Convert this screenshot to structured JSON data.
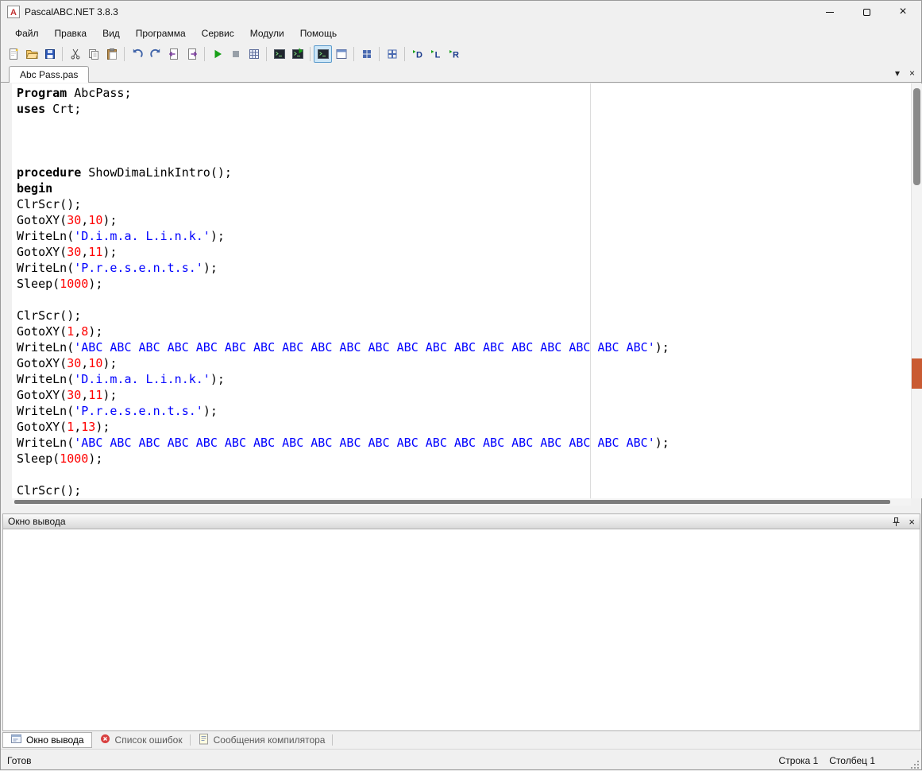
{
  "window": {
    "title": "PascalABC.NET 3.8.3"
  },
  "icons": {
    "window_close": "×",
    "tab_dropdown": "▾",
    "tab_close": "×",
    "output_close": "×"
  },
  "menu": {
    "items": [
      {
        "key": "file",
        "label": "Файл"
      },
      {
        "key": "edit",
        "label": "Правка"
      },
      {
        "key": "view",
        "label": "Вид"
      },
      {
        "key": "program",
        "label": "Программа"
      },
      {
        "key": "service",
        "label": "Сервис"
      },
      {
        "key": "modules",
        "label": "Модули"
      },
      {
        "key": "help",
        "label": "Помощь"
      }
    ]
  },
  "toolbar": {
    "groups": [
      [
        {
          "key": "new-file"
        },
        {
          "key": "open-file"
        },
        {
          "key": "save-file"
        }
      ],
      [
        {
          "key": "cut"
        },
        {
          "key": "copy"
        },
        {
          "key": "paste"
        }
      ],
      [
        {
          "key": "undo"
        },
        {
          "key": "redo"
        },
        {
          "key": "nav-back"
        },
        {
          "key": "nav-forward"
        }
      ],
      [
        {
          "key": "run"
        },
        {
          "key": "stop"
        },
        {
          "key": "expression-pad"
        }
      ],
      [
        {
          "key": "output-window"
        },
        {
          "key": "run-console"
        }
      ],
      [
        {
          "key": "console-toggle",
          "active": true
        },
        {
          "key": "form-designer"
        }
      ],
      [
        {
          "key": "watch-window"
        }
      ],
      [
        {
          "key": "templates-window"
        }
      ],
      [
        {
          "key": "module-d",
          "letter": "D"
        },
        {
          "key": "module-l",
          "letter": "L"
        },
        {
          "key": "module-r",
          "letter": "R"
        }
      ]
    ]
  },
  "tab_bar": {
    "tabs": [
      {
        "key": "abc-pass",
        "label": "Abc Pass.pas",
        "active": true
      }
    ]
  },
  "editor": {
    "margin_column": 80,
    "lines": [
      [
        [
          "k",
          "Program"
        ],
        [
          "p",
          " AbcPass;"
        ]
      ],
      [
        [
          "k",
          "uses"
        ],
        [
          "p",
          " Crt;"
        ]
      ],
      [],
      [],
      [],
      [
        [
          "k",
          "procedure"
        ],
        [
          "p",
          " ShowDimaLinkIntro();"
        ]
      ],
      [
        [
          "k",
          "begin"
        ]
      ],
      [
        [
          "p",
          "ClrScr();"
        ]
      ],
      [
        [
          "p",
          "GotoXY("
        ],
        [
          "n",
          "30"
        ],
        [
          "p",
          ","
        ],
        [
          "n",
          "10"
        ],
        [
          "p",
          ");"
        ]
      ],
      [
        [
          "p",
          "WriteLn("
        ],
        [
          "s",
          "'D.i.m.a. L.i.n.k.'"
        ],
        [
          "p",
          ");"
        ]
      ],
      [
        [
          "p",
          "GotoXY("
        ],
        [
          "n",
          "30"
        ],
        [
          "p",
          ","
        ],
        [
          "n",
          "11"
        ],
        [
          "p",
          ");"
        ]
      ],
      [
        [
          "p",
          "WriteLn("
        ],
        [
          "s",
          "'P.r.e.s.e.n.t.s.'"
        ],
        [
          "p",
          ");"
        ]
      ],
      [
        [
          "p",
          "Sleep("
        ],
        [
          "n",
          "1000"
        ],
        [
          "p",
          ");"
        ]
      ],
      [],
      [
        [
          "p",
          "ClrScr();"
        ]
      ],
      [
        [
          "p",
          "GotoXY("
        ],
        [
          "n",
          "1"
        ],
        [
          "p",
          ","
        ],
        [
          "n",
          "8"
        ],
        [
          "p",
          ");"
        ]
      ],
      [
        [
          "p",
          "WriteLn("
        ],
        [
          "s",
          "'ABC ABC ABC ABC ABC ABC ABC ABC ABC ABC ABC ABC ABC ABC ABC ABC ABC ABC ABC ABC'"
        ],
        [
          "p",
          ");"
        ]
      ],
      [
        [
          "p",
          "GotoXY("
        ],
        [
          "n",
          "30"
        ],
        [
          "p",
          ","
        ],
        [
          "n",
          "10"
        ],
        [
          "p",
          ");"
        ]
      ],
      [
        [
          "p",
          "WriteLn("
        ],
        [
          "s",
          "'D.i.m.a. L.i.n.k.'"
        ],
        [
          "p",
          ");"
        ]
      ],
      [
        [
          "p",
          "GotoXY("
        ],
        [
          "n",
          "30"
        ],
        [
          "p",
          ","
        ],
        [
          "n",
          "11"
        ],
        [
          "p",
          ");"
        ]
      ],
      [
        [
          "p",
          "WriteLn("
        ],
        [
          "s",
          "'P.r.e.s.e.n.t.s.'"
        ],
        [
          "p",
          ");"
        ]
      ],
      [
        [
          "p",
          "GotoXY("
        ],
        [
          "n",
          "1"
        ],
        [
          "p",
          ","
        ],
        [
          "n",
          "13"
        ],
        [
          "p",
          ");"
        ]
      ],
      [
        [
          "p",
          "WriteLn("
        ],
        [
          "s",
          "'ABC ABC ABC ABC ABC ABC ABC ABC ABC ABC ABC ABC ABC ABC ABC ABC ABC ABC ABC ABC'"
        ],
        [
          "p",
          ");"
        ]
      ],
      [
        [
          "p",
          "Sleep("
        ],
        [
          "n",
          "1000"
        ],
        [
          "p",
          ");"
        ]
      ],
      [],
      [
        [
          "p",
          "ClrScr();"
        ]
      ]
    ]
  },
  "output_panel": {
    "title": "Окно вывода"
  },
  "bottom_tabs": [
    {
      "key": "output",
      "label": "Окно вывода",
      "icon": "output-window",
      "active": true
    },
    {
      "key": "error-list",
      "label": "Список ошибок",
      "icon": "error-cross",
      "active": false
    },
    {
      "key": "compiler-messages",
      "label": "Сообщения компилятора",
      "icon": "message-note",
      "active": false
    }
  ],
  "status_bar": {
    "ready": "Готов",
    "line_info": "Строка 1",
    "column_info": "Столбец 1"
  },
  "colors": {
    "kw": "#000000",
    "str": "#0000ff",
    "num": "#ff0000",
    "marker": "#c95b33",
    "run": "#18a018",
    "toolbar_active_bg": "#cde6f7",
    "toolbar_active_border": "#5e9ccc"
  }
}
